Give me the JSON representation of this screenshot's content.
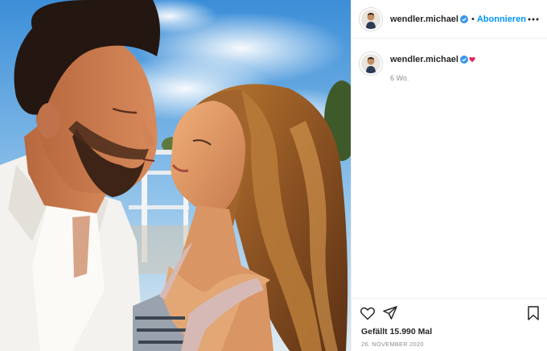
{
  "post": {
    "username": "wendler.michael",
    "dot": "•",
    "follow_label": "Abonnieren",
    "more_icon": "more-horizontal-icon",
    "caption": {
      "username": "wendler.michael",
      "time_ago": "6 Wo."
    },
    "actions": {
      "like_icon": "heart-outline-icon",
      "share_icon": "paper-plane-icon",
      "save_icon": "bookmark-icon"
    },
    "likes_text": "Gefällt 15.990 Mal",
    "date_text": "26. NOVEMBER 2020"
  },
  "colors": {
    "accent": "#0095f6",
    "verified": "#3897f0",
    "muted": "#8e8e8e",
    "divider": "#efefef"
  }
}
